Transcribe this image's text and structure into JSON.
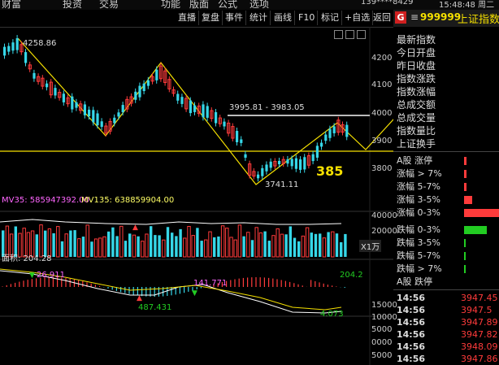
{
  "menu": [
    "财富",
    "投资",
    "交易",
    "功能",
    "版面",
    "公式",
    "选项"
  ],
  "status": {
    "account": "139****8429",
    "datetime": "15:48:48 周二"
  },
  "toolbar": {
    "buttons": [
      "直播",
      "复盘",
      "事件",
      "统计",
      "画线",
      "F10",
      "标记",
      "+自选",
      "返回"
    ]
  },
  "index": {
    "marker": "G",
    "code": "999999",
    "name": "上证指数"
  },
  "right_panel": {
    "stats": [
      "最新指数",
      "今日开盘",
      "昨日收盘",
      "指数涨跌",
      "指数涨幅",
      "总成交额",
      "总成交量",
      "指数量比",
      "上证换手"
    ],
    "dist": [
      {
        "label": "A股 涨停"
      },
      {
        "label": "涨幅 > 7%"
      },
      {
        "label": "涨幅 5-7%"
      },
      {
        "label": "涨幅 3-5%"
      },
      {
        "label": "涨幅 0-3%"
      },
      {
        "label": "跌幅 0-3%"
      },
      {
        "label": "跌幅 3-5%"
      },
      {
        "label": "跌幅 5-7%"
      },
      {
        "label": "跌幅 > 7%"
      },
      {
        "label": "A股 跌停"
      }
    ],
    "ticks": [
      {
        "time": "14:56",
        "price": "3947.45"
      },
      {
        "time": "14:56",
        "price": "3947.5"
      },
      {
        "time": "14:56",
        "price": "3947.89"
      },
      {
        "time": "14:56",
        "price": "3947.82"
      },
      {
        "time": "14:56",
        "price": "3948.09"
      },
      {
        "time": "14:56",
        "price": "3947.86"
      }
    ]
  },
  "main_chart": {
    "y_ticks": [
      "4200",
      "4100",
      "4000",
      "3900",
      "3800"
    ],
    "annotations": {
      "high": "4258.86",
      "resistance": "3995.81 - 3983.05",
      "low": "3741.11",
      "count": "385"
    }
  },
  "volume": {
    "ma_label_1": "MV35: 585947392.00",
    "ma_label_2": "MV135: 638859904.00",
    "y_ticks": [
      "40000",
      "20000"
    ],
    "unit": "X1万"
  },
  "macd": {
    "title": "面积: 204.28",
    "labels": {
      "a": "26.911",
      "b": "141.771",
      "c": "487.431",
      "d": "204.2",
      "e": "4.073"
    },
    "y_ticks": [
      "15000",
      "10000",
      "5000",
      "0000",
      "5000"
    ]
  },
  "colors": {
    "up": "#ff3b3b",
    "down": "#36d7e8",
    "yellow": "#f5e000",
    "green": "#22cc22"
  }
}
